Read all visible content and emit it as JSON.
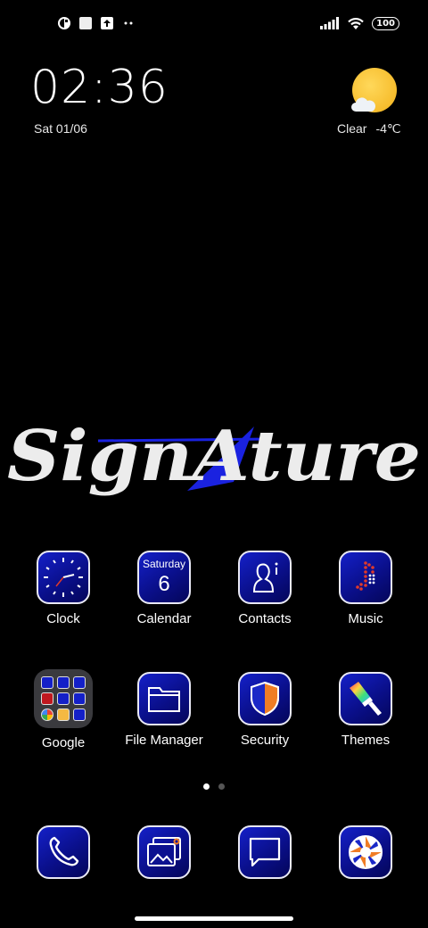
{
  "status_bar": {
    "left_icons": [
      "app-notification-icon",
      "square-notification-icon",
      "upload-notification-icon",
      "more-dots-icon"
    ],
    "right_icons": [
      "signal-icon",
      "wifi-icon"
    ],
    "battery": "100"
  },
  "clock_widget": {
    "time": "02:36",
    "date": "Sat 01/06"
  },
  "weather_widget": {
    "condition": "Clear",
    "temperature": "-4℃",
    "icon": "sun-cloud-icon"
  },
  "wallpaper": {
    "logo_text": "SignAture",
    "accent": "#1a22e0"
  },
  "apps": {
    "clock": {
      "label": "Clock",
      "icon": "clock-icon"
    },
    "calendar": {
      "label": "Calendar",
      "icon": "calendar-icon",
      "day_name": "Saturday",
      "day_num": "6"
    },
    "contacts": {
      "label": "Contacts",
      "icon": "contacts-icon"
    },
    "music": {
      "label": "Music",
      "icon": "music-icon"
    },
    "google": {
      "label": "Google",
      "icon": "google-folder-icon"
    },
    "file_manager": {
      "label": "File Manager",
      "icon": "folder-icon"
    },
    "security": {
      "label": "Security",
      "icon": "shield-icon"
    },
    "themes": {
      "label": "Themes",
      "icon": "paintbrush-icon"
    }
  },
  "dock": [
    "phone-icon",
    "gallery-icon",
    "messages-icon",
    "camera-icon"
  ],
  "page_indicator": {
    "pages": 2,
    "current": 1
  },
  "colors": {
    "icon_gradient_top": "#1420c8",
    "icon_gradient_bottom": "#04065a",
    "icon_border": "#e9e9f5"
  }
}
